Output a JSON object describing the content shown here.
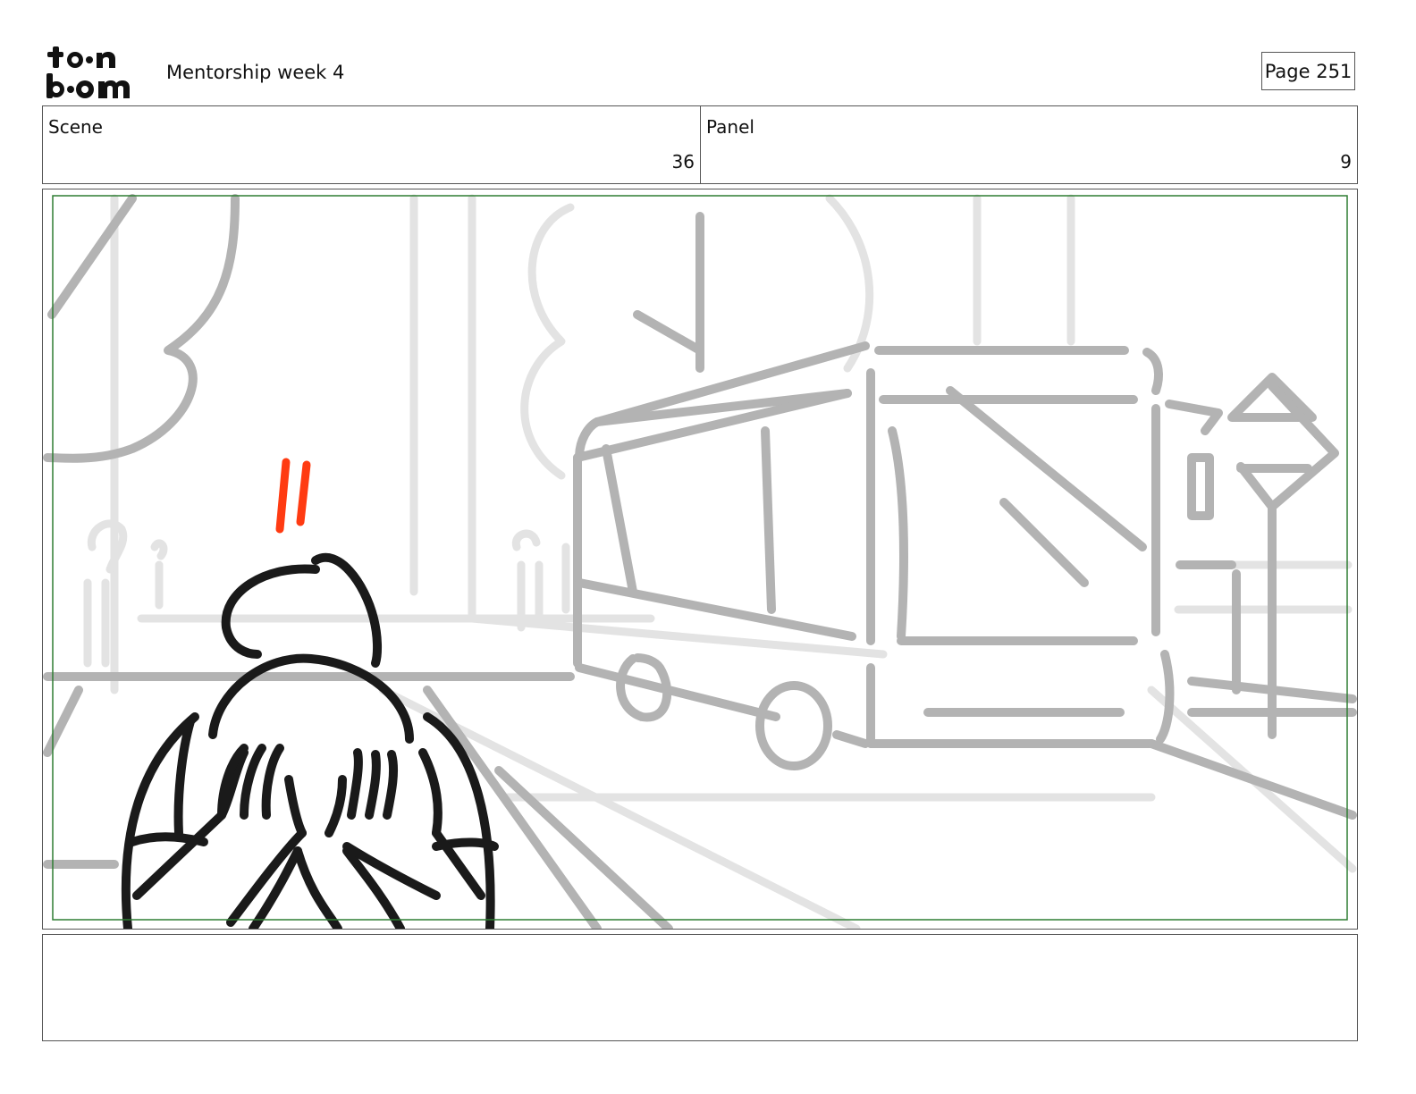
{
  "header": {
    "logo_text": "toon boom",
    "title": "Mentorship week 4",
    "page_label": "Page 251"
  },
  "info": {
    "scene_label": "Scene",
    "scene_value": "36",
    "panel_label": "Panel",
    "panel_value": "9"
  },
  "frame": {
    "safe_area_color": "#2e7d32",
    "sketch_colors": {
      "background": "#b3b3b3",
      "faint": "#e3e3e3",
      "character": "#1a1a1a",
      "accent": "#ff3b12"
    }
  },
  "notes": {
    "text": ""
  }
}
